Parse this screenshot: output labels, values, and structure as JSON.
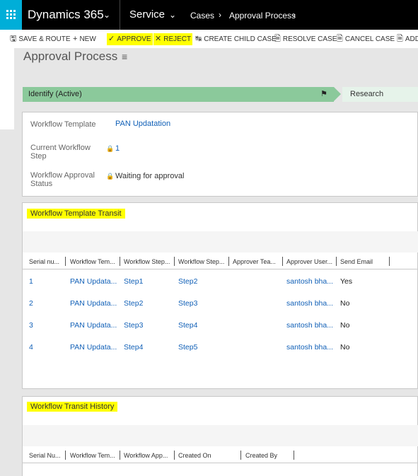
{
  "topnav": {
    "brand": "Dynamics 365",
    "area": "Service",
    "breadcrumb": [
      "Cases",
      "Approval Process"
    ]
  },
  "commands": {
    "save_route": "SAVE & ROUTE",
    "new": "NEW",
    "approve": "APPROVE",
    "reject": "REJECT",
    "create_child_case": "CREATE CHILD CASE",
    "resolve_case": "RESOLVE CASE",
    "cancel_case": "CANCEL CASE",
    "add": "ADD"
  },
  "page": {
    "title": "Approval Process"
  },
  "bpf": {
    "active_stage": "Identify (Active)",
    "next_stage": "Research",
    "active_color": "#8bc99b"
  },
  "summary": {
    "template_label": "Workflow Template",
    "template_value": "PAN Updatation",
    "step_label_1": "Current Workflow",
    "step_label_2": "Step",
    "step_value": "1",
    "status_label_1": "Workflow Approval",
    "status_label_2": "Status",
    "status_value": "Waiting for approval"
  },
  "transit": {
    "title": "Workflow Template Transit",
    "columns": [
      "Serial nu...",
      "Workflow Tem...",
      "Workflow Step...",
      "Workflow Step...",
      "Approver Tea...",
      "Approver User...",
      "Send Email"
    ],
    "rows": [
      {
        "serial": "1",
        "template": "PAN Updata...",
        "from": "Step1",
        "to": "Step2",
        "team": "",
        "user": "santosh bha...",
        "email": "Yes"
      },
      {
        "serial": "2",
        "template": "PAN Updata...",
        "from": "Step2",
        "to": "Step3",
        "team": "",
        "user": "santosh bha...",
        "email": "No"
      },
      {
        "serial": "3",
        "template": "PAN Updata...",
        "from": "Step3",
        "to": "Step4",
        "team": "",
        "user": "santosh bha...",
        "email": "No"
      },
      {
        "serial": "4",
        "template": "PAN Updata...",
        "from": "Step4",
        "to": "Step5",
        "team": "",
        "user": "santosh bha...",
        "email": "No"
      }
    ]
  },
  "history": {
    "title": "Workflow Transit History",
    "columns": [
      "Serial Nu...",
      "Workflow Tem...",
      "Workflow App...",
      "Created On",
      "Created By"
    ]
  },
  "colors": {
    "highlight": "#ffff00",
    "link": "#1160b7",
    "waffle": "#00aed8"
  }
}
